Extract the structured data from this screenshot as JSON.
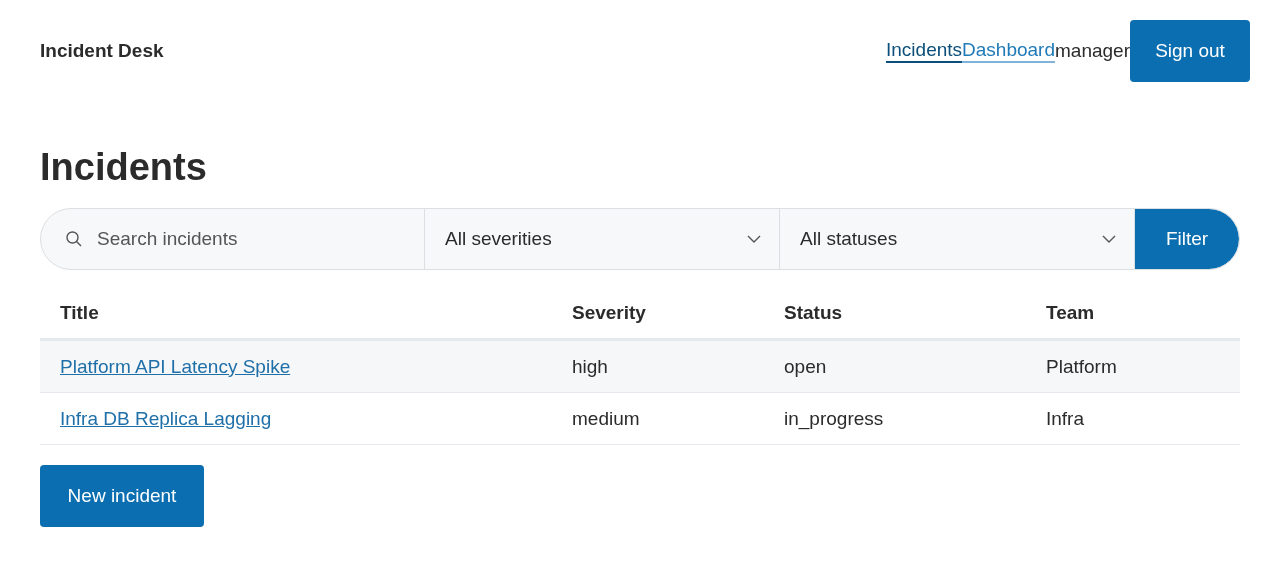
{
  "brand": "Incident Desk",
  "nav": [
    {
      "label": "Incidents",
      "selected": true
    },
    {
      "label": "Dashboard",
      "selected": false
    }
  ],
  "user": "manager",
  "sign_out": "Sign out",
  "heading": "Incidents",
  "filters": {
    "search": {
      "placeholder": "Search incidents"
    },
    "severity": "All severities",
    "status": "All statuses",
    "button": "Filter"
  },
  "table": {
    "columns": [
      "Title",
      "Severity",
      "Status",
      "Team"
    ],
    "rows": [
      {
        "title": "Platform API Latency Spike",
        "severity": "high",
        "status": "open",
        "team": "Platform"
      },
      {
        "title": "Infra DB Replica Lagging",
        "severity": "medium",
        "status": "in_progress",
        "team": "Infra"
      }
    ]
  },
  "new_button": "New incident"
}
